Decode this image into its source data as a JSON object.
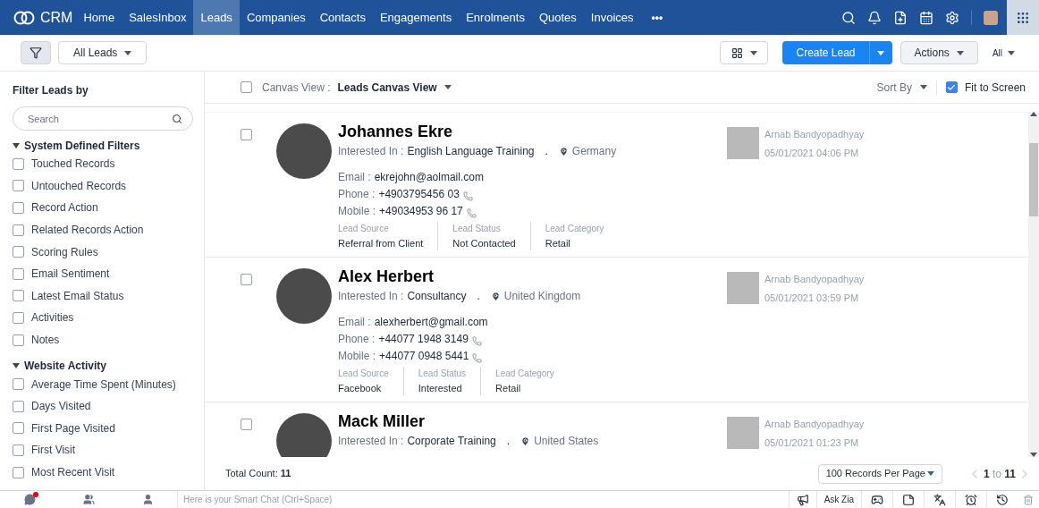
{
  "nav": {
    "logo": "CRM",
    "items": [
      {
        "label": "Home",
        "selected": false
      },
      {
        "label": "SalesInbox",
        "selected": false
      },
      {
        "label": "Leads",
        "selected": true
      },
      {
        "label": "Companies",
        "selected": false
      },
      {
        "label": "Contacts",
        "selected": false
      },
      {
        "label": "Engagements",
        "selected": false
      },
      {
        "label": "Enrolments",
        "selected": false
      },
      {
        "label": "Quotes",
        "selected": false
      },
      {
        "label": "Invoices",
        "selected": false
      }
    ],
    "more": "•••"
  },
  "toolbar": {
    "view": "All Leads",
    "create": "Create Lead",
    "actions": "Actions",
    "scope": "All"
  },
  "sidebar": {
    "title": "Filter Leads by",
    "search": {
      "placeholder": "Search"
    },
    "groups": [
      {
        "title": "System Defined Filters",
        "expanded": true,
        "items": [
          {
            "label": "Touched Records",
            "checked": false
          },
          {
            "label": "Untouched Records",
            "checked": false
          },
          {
            "label": "Record Action",
            "checked": false
          },
          {
            "label": "Related Records Action",
            "checked": false
          },
          {
            "label": "Scoring Rules",
            "checked": false
          },
          {
            "label": "Email Sentiment",
            "checked": false
          },
          {
            "label": "Latest Email Status",
            "checked": false
          },
          {
            "label": "Activities",
            "checked": false
          },
          {
            "label": "Notes",
            "checked": false
          }
        ]
      },
      {
        "title": "Website Activity",
        "expanded": true,
        "items": [
          {
            "label": "Average Time Spent (Minutes)",
            "checked": false
          },
          {
            "label": "Days Visited",
            "checked": false
          },
          {
            "label": "First Page Visited",
            "checked": false
          },
          {
            "label": "First Visit",
            "checked": false
          },
          {
            "label": "Most Recent Visit",
            "checked": false
          }
        ]
      }
    ]
  },
  "header": {
    "select_all_checked": false,
    "canvas_label": "Canvas View :",
    "canvas": "Leads Canvas View",
    "sort": "Sort By",
    "fit": {
      "label": "Fit to Screen",
      "checked": true
    }
  },
  "leads": [
    {
      "checked": false,
      "name": "Johannes Ekre",
      "interested_label": "Interested In :",
      "interest": "English Language Training",
      "separator": ".",
      "location": "Germany",
      "contacts": [
        {
          "label": "Email :",
          "value": "ekrejohn@aolmail.com",
          "kind": "email"
        },
        {
          "label": "Phone :",
          "value": "+4903795456 03",
          "kind": "phone"
        },
        {
          "label": "Mobile :",
          "value": "+49034953 96 17",
          "kind": "phone"
        }
      ],
      "fields": [
        {
          "label": "Lead Source",
          "value": "Referral from Client"
        },
        {
          "label": "Lead Status",
          "value": "Not Contacted"
        },
        {
          "label": "Lead Category",
          "value": "Retail"
        }
      ],
      "owner": "Arnab Bandyopadhyay",
      "date": "05/01/2021 04:06 PM"
    },
    {
      "checked": false,
      "name": "Alex Herbert",
      "interested_label": "Interested In :",
      "interest": "Consultancy",
      "separator": ".",
      "location": "United Kingdom",
      "contacts": [
        {
          "label": "Email :",
          "value": "alexherbert@gmail.com",
          "kind": "email"
        },
        {
          "label": "Phone :",
          "value": "+44077 1948 3149",
          "kind": "phone"
        },
        {
          "label": "Mobile :",
          "value": "+44077 0948 5441",
          "kind": "phone"
        }
      ],
      "fields": [
        {
          "label": "Lead Source",
          "value": "Facebook"
        },
        {
          "label": "Lead Status",
          "value": "Interested"
        },
        {
          "label": "Lead Category",
          "value": "Retail"
        }
      ],
      "owner": "Arnab Bandyopadhyay",
      "date": "05/01/2021 03:59 PM"
    },
    {
      "checked": false,
      "name": "Mack Miller",
      "interested_label": "Interested In :",
      "interest": "Corporate Training",
      "separator": ".",
      "location": "United States",
      "owner": "Arnab Bandyopadhyay",
      "date": "05/01/2021 01:23 PM"
    }
  ],
  "footer": {
    "total_label": "Total Count:",
    "total": "11",
    "per_page": "100 Records Per Page",
    "page_from": "1",
    "page_to_word": "to",
    "page_to": "11"
  },
  "bottom_bar": {
    "chats_unread": true,
    "chat_placeholder": "Here is your Smart Chat (Ctrl+Space)",
    "ask_zia": "Ask Zia"
  }
}
